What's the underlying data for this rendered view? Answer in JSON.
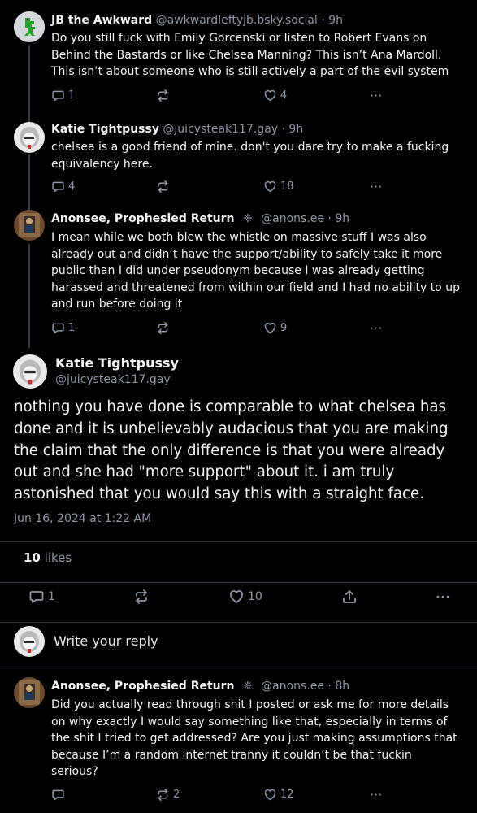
{
  "posts": [
    {
      "name": "JB the Awkward",
      "handle": "@awkwardleftyjb.bsky.social",
      "time": "9h",
      "text": "Do you still fuck with Emily Gorcenski or listen to Robert Evans on Behind the Bastards or like Chelsea Manning? This isn’t Ana Mardoll. This isn’t about someone who is still actively a part of the evil system",
      "replies": "1",
      "reposts": "",
      "likes": "4"
    },
    {
      "name": "Katie Tightpussy",
      "handle": "@juicysteak117.gay",
      "time": "9h",
      "text": "chelsea is a good friend of mine. don't you dare try to make a fucking equivalency here.",
      "replies": "4",
      "reposts": "",
      "likes": "18"
    },
    {
      "name": "Anonsee, Prophesied Return",
      "emoji": "❈",
      "handle": "@anons.ee",
      "time": "9h",
      "text": "I mean while we both blew the whistle on massive stuff I was also already out and didn’t have the support/ability to safely take it more public than I did under pseudonym because I was already getting harassed and threatened from within our field and I had no ability to up and run before doing it",
      "replies": "1",
      "reposts": "",
      "likes": "9"
    }
  ],
  "main_post": {
    "name": "Katie Tightpussy",
    "handle": "@juicysteak117.gay",
    "text": "nothing you have done is comparable to what chelsea has done and it is unbelievably audacious that you are making the claim that the only difference is that you were already out and she had \"more support\" about it. i am truly astonished that you would say this with a straight face.",
    "timestamp": "Jun 16, 2024 at 1:22 AM",
    "likes_count": "10",
    "likes_label": "likes",
    "replies": "1",
    "reposts": "",
    "likes": "10"
  },
  "composer": {
    "placeholder": "Write your reply"
  },
  "reply": {
    "name": "Anonsee, Prophesied Return",
    "emoji": "❈",
    "handle": "@anons.ee",
    "time": "8h",
    "text": "Did you actually read through shit I posted or ask me for more details on why exactly I would say something like that, especially in terms of the shit I tried to get addressed? Are you just making assumptions that because I’m a random internet tranny it couldn’t be that fuckin serious?",
    "replies": "",
    "reposts": "2",
    "likes": "12"
  },
  "separator": "·",
  "icons": {
    "reply": "speech-bubble-icon",
    "repost": "repost-arrows-icon",
    "like": "heart-icon",
    "share": "share-upload-icon",
    "more": "more-dots-icon"
  },
  "colors": {
    "background": "#000000",
    "text": "#f1f3f5",
    "muted": "#8b98a5",
    "thread_line": "#333c47"
  }
}
